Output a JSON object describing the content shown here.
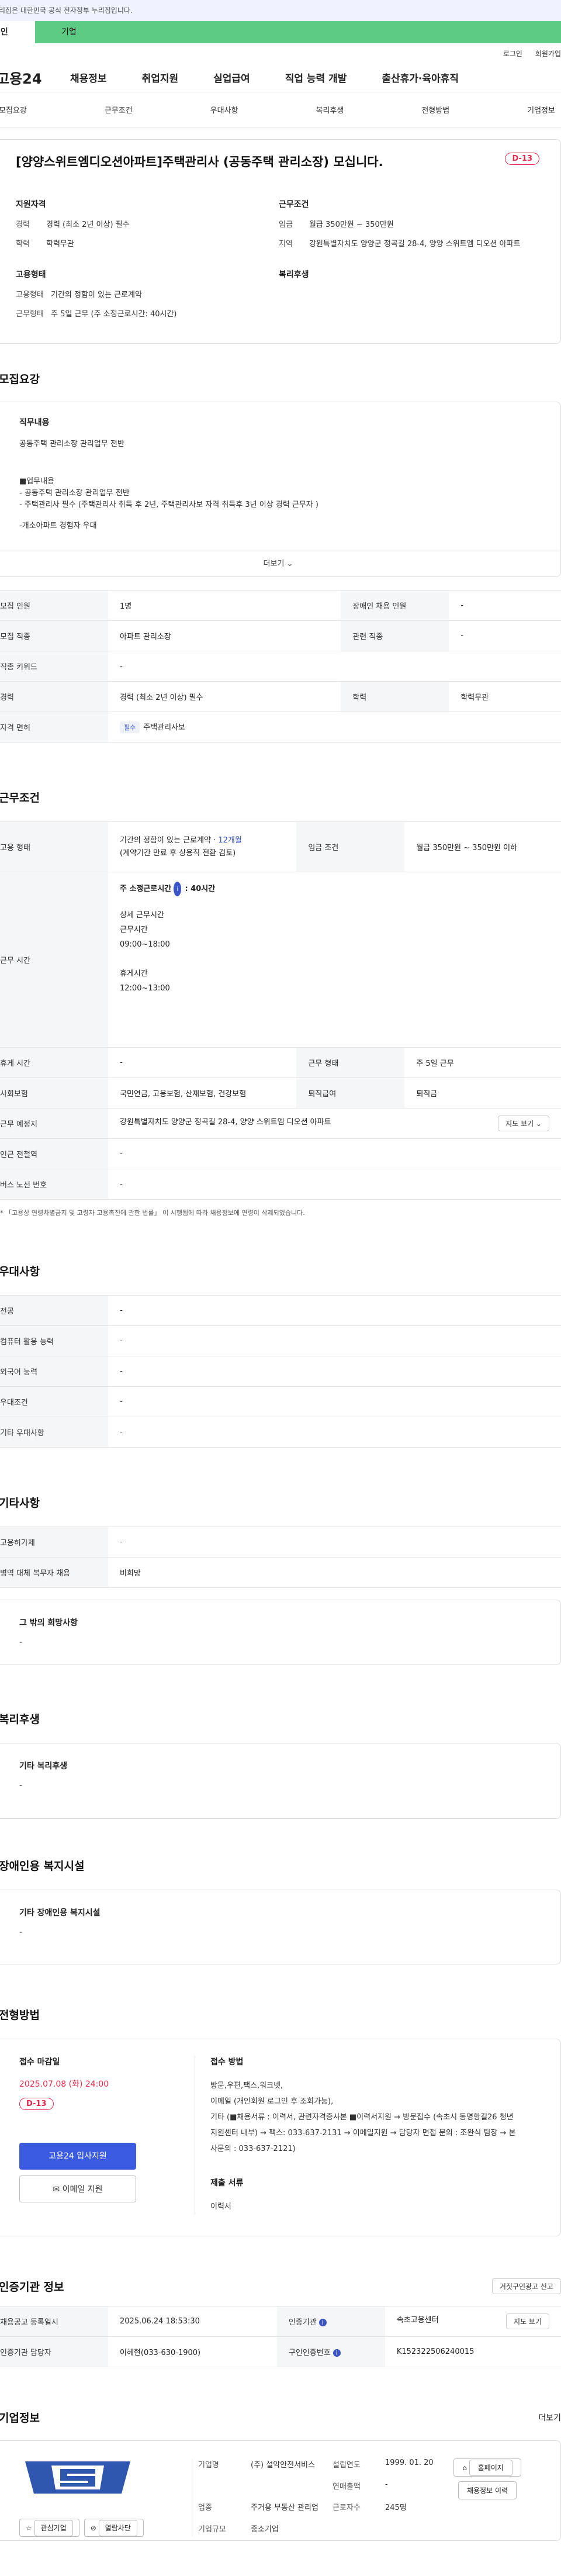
{
  "gov_banner": "이 누리집은 대한민국 공식 전자정부 누리집입니다.",
  "tabs": [
    "개인",
    "기업"
  ],
  "util": [
    "로그인",
    "회원가입"
  ],
  "logo": "고용24",
  "gnb": [
    "채용정보",
    "취업지원",
    "실업급여",
    "직업 능력 개발",
    "출산휴가·육아휴직"
  ],
  "subnav": [
    "모집요강",
    "근무조건",
    "우대사항",
    "복리후생",
    "전형방법",
    "기업정보"
  ],
  "job": {
    "title": "[양양스위트엠디오션아파트]주택관리사 (공동주택 관리소장) 모십니다.",
    "dday": "D-13",
    "applicant_title": "지원자격",
    "applicant": [
      {
        "k": "경력",
        "v": "경력 (최소 2년 이상) 필수"
      },
      {
        "k": "학력",
        "v": "학력무관"
      }
    ],
    "employment_title": "고용형태",
    "employment": [
      {
        "k": "고용형태",
        "v": "기간의 정함이 있는 근로계약"
      },
      {
        "k": "근무형태",
        "v": "주 5일 근무 (주 소정근로시간: 40시간)"
      }
    ],
    "condition_title": "근무조건",
    "condition": [
      {
        "k": "임금",
        "v": "월급 350만원 ~ 350만원"
      },
      {
        "k": "지역",
        "v": "강원특별자치도 양양군 정곡길 28-4, 양양 스위트엠 디오션 아파트"
      }
    ],
    "welfare_title": "복리후생"
  },
  "recruit": {
    "title": "모집요강",
    "duty_title": "직무내용",
    "duty_lines": [
      "공동주택 관리소장  관리업무 전반",
      "",
      "■업무내용",
      "- 공동주택 관리소장  관리업무 전반",
      "- 주택관리사 필수 (주택관리사 취득 후 2년, 주택관리사보 자격 취득후 3년 이상 경력 근무자 )",
      "",
      "-개소아파트 경험자 우대"
    ],
    "more": "더보기 ⌄",
    "rows": [
      {
        "k": "모집 인원",
        "v": "1명",
        "k2": "장애인 채용 인원",
        "v2": "-"
      },
      {
        "k": "모집 직종",
        "v": "아파트 관리소장",
        "k2": "관련 직종",
        "v2": "-"
      },
      {
        "k": "직종 키워드",
        "v": "-"
      },
      {
        "k": "경력",
        "v": "경력 (최소 2년 이상) 필수",
        "k2": "학력",
        "v2": "학력무관"
      }
    ],
    "license_label": "자격 면허",
    "license_tag": "필수",
    "license_value": "주택관리사보"
  },
  "work": {
    "title": "근무조건",
    "employ_label": "고용 형태",
    "employ_value_a": "기간의 정함이 있는 근로계약 · ",
    "employ_value_b": "12개월",
    "employ_value_c": "(계약기간 만료 후 상용직 전환 검토)",
    "wage_label": "임금 조건",
    "wage_value": "월급 350만원 ~ 350만원 이하",
    "hours_label": "근무 시간",
    "hours_head": "주 소정근로시간",
    "hours_head_val": ": 40시간",
    "hours_detail": [
      "상세 근무시간",
      "근무시간",
      "09:00~18:00",
      "",
      "휴게시간",
      "12:00~13:00"
    ],
    "rows": [
      {
        "k": "휴게 시간",
        "v": "-",
        "k2": "근무 형태",
        "v2": "주 5일 근무"
      },
      {
        "k": "사회보험",
        "v": "국민연금, 고용보험, 산재보험, 건강보험",
        "k2": "퇴직급여",
        "v2": "퇴직금"
      }
    ],
    "addr_label": "근무 예정지",
    "addr_value": "강원특별자치도 양양군 정곡길 28-4, 양양 스위트엠 디오션 아파트",
    "map_btn": "지도 보기 ⌄",
    "near_label": "인근 전철역",
    "near_value": "-",
    "bus_label": "버스 노선 번호",
    "bus_value": "-",
    "note": "* 「고용상 연령차별금지 및 고령자 고용촉진에 관한 법률」 이 시행됨에 따라 채용정보에 연령이 삭제되었습니다."
  },
  "pref": {
    "title": "우대사항",
    "rows": [
      {
        "k": "전공",
        "v": "-"
      },
      {
        "k": "컴퓨터 활용 능력",
        "v": "-"
      },
      {
        "k": "외국어 능력",
        "v": "-"
      },
      {
        "k": "우대조건",
        "v": "-"
      },
      {
        "k": "기타 우대사항",
        "v": "-"
      }
    ]
  },
  "etc": {
    "title": "기타사항",
    "rows": [
      {
        "k": "고용허가제",
        "v": "-"
      },
      {
        "k": "병역 대체 복무자 채용",
        "v": "비희망"
      }
    ],
    "other_title": "그 밖의 희망사항",
    "other_value": "-"
  },
  "welfare": {
    "title": "복리후생",
    "box_title": "기타 복리후생",
    "value": "-"
  },
  "disabled": {
    "title": "장애인용 복지시설",
    "box_title": "기타 장애인용 복지시설",
    "value": "-"
  },
  "process": {
    "title": "전형방법",
    "deadline_title": "접수 마감일",
    "deadline": "2025.07.08 (화) 24:00",
    "dday": "D-13",
    "apply_btn": "고용24 입사지원",
    "email_btn": "이메일 지원",
    "method_title": "접수 방법",
    "method_lines": [
      "방문,우편,팩스,워크넷,",
      "이메일 (개인회원 로그인 후 조회가능),",
      "기타 (■채용서류 : 이력서, 관련자격증사본 ■이력서지원 → 방문접수 (속초시 동명항길26 청년",
      "지원센터 내부) → 팩스: 033-637-2131  → 이메일지원 → 담당자 면접 문의 : 조완식 팀장 → 본",
      "사문의 : 033-637-2121)"
    ],
    "docs_title": "제출 서류",
    "docs_value": "이력서"
  },
  "agency": {
    "title": "인증기관 정보",
    "report_btn": "거짓구인광고 신고",
    "rows": [
      {
        "k": "채용공고 등록일시",
        "v": "2025.06.24 18:53:30",
        "k2": "인증기관",
        "v2": "속초고용센터",
        "btn": "지도 보기"
      },
      {
        "k": "인증기관 담당자",
        "v": "이혜현(033-630-1900)",
        "k2": "구인인증번호",
        "v2": "K152322506240015"
      }
    ]
  },
  "company": {
    "title": "기업정보",
    "more": "더보기",
    "fav_btn": "관심기업",
    "block_btn": "열람차단",
    "info": [
      {
        "k": "기업명",
        "v": "(주) 설악안전서비스",
        "k2": "설립연도",
        "v2": "1999. 01. 20"
      },
      {
        "k": "",
        "v": "",
        "k2": "연매출액",
        "v2": "-"
      },
      {
        "k": "업종",
        "v": "주거용 부동산 관리업",
        "k2": "근로자수",
        "v2": "245명"
      },
      {
        "k": "기업규모",
        "v": "중소기업",
        "k2": "",
        "v2": ""
      }
    ],
    "home_btn": "홈페이지",
    "jobs_btn": "채용정보 이력"
  }
}
